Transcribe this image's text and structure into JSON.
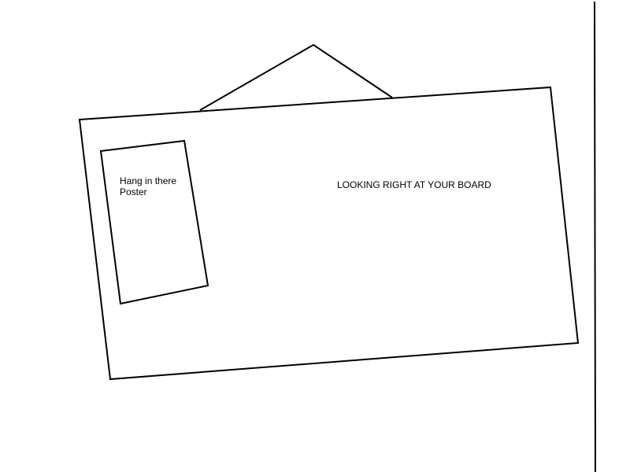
{
  "poster": {
    "line1": "Hang in there",
    "line2": "Poster"
  },
  "board": {
    "label": "LOOKING RIGHT AT YOUR BOARD"
  },
  "colors": {
    "stroke": "#000000",
    "background": "#ffffff"
  }
}
